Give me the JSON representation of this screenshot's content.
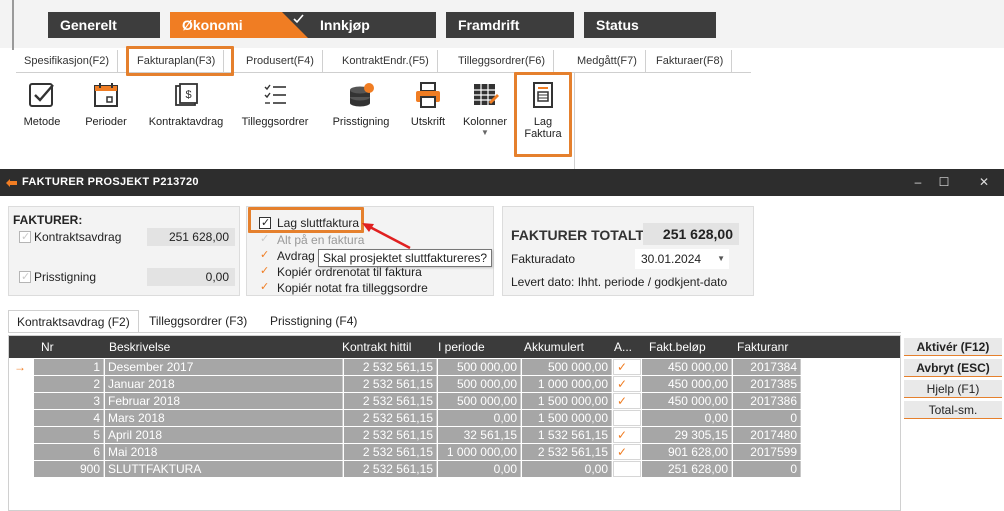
{
  "module_tabs": [
    {
      "label": "Generelt"
    },
    {
      "label": "Økonomi"
    },
    {
      "label": "Innkjøp"
    },
    {
      "label": "Framdrift"
    },
    {
      "label": "Status"
    }
  ],
  "ribbon_tabs": [
    {
      "label": "Spesifikasjon(F2)"
    },
    {
      "label": "Fakturaplan(F3)"
    },
    {
      "label": "Produsert(F4)"
    },
    {
      "label": "KontraktEndr.(F5)"
    },
    {
      "label": "Tilleggsordrer(F6)"
    },
    {
      "label": "Medgått(F7)"
    },
    {
      "label": "Fakturaer(F8)"
    }
  ],
  "tools": [
    {
      "label": "Metode",
      "icon": "checkbox-icon"
    },
    {
      "label": "Perioder",
      "icon": "calendar-icon"
    },
    {
      "label": "Kontraktavdrag",
      "icon": "money-icon"
    },
    {
      "label": "Tilleggsordrer",
      "icon": "list-icon"
    },
    {
      "label": "Prisstigning",
      "icon": "coins-icon"
    },
    {
      "label": "Utskrift",
      "icon": "printer-icon"
    },
    {
      "label": "Kolonner",
      "icon": "columns-icon"
    },
    {
      "label": "Lag",
      "label2": "Faktura",
      "icon": "invoice-icon"
    }
  ],
  "window": {
    "title": "FAKTURER PROSJEKT P213720",
    "min": "–",
    "max": "☐",
    "close": "✕"
  },
  "fakturer": {
    "header": "FAKTURER:",
    "kontraktsavdrag_label": "Kontraktsavdrag",
    "kontraktsavdrag_value": "251 628,00",
    "prisstigning_label": "Prisstigning",
    "prisstigning_value": "0,00"
  },
  "options": {
    "lag_sluttfaktura": "Lag sluttfaktura",
    "alt_pa_en": "Alt på en faktura",
    "avdrag_og": "Avdrag og",
    "kopier_ordrenotat": "Kopiér ordrenotat til faktura",
    "kopier_notat": "Kopiér notat fra tilleggsordre",
    "tooltip": "Skal prosjektet sluttfaktureres?"
  },
  "totals": {
    "label": "FAKTURER TOTALT:",
    "value": "251 628,00",
    "fakturadato_label": "Fakturadato",
    "fakturadato_value": "30.01.2024",
    "levert": "Levert dato: Ihht. periode / godkjent-dato"
  },
  "grid_tabs": [
    {
      "label": "Kontraktsavdrag (F2)"
    },
    {
      "label": "Tilleggsordrer (F3)"
    },
    {
      "label": "Prisstigning (F4)"
    }
  ],
  "grid": {
    "columns": [
      "Nr",
      "Beskrivelse",
      "Kontrakt hittil",
      "I periode",
      "Akkumulert",
      "A...",
      "Fakt.beløp",
      "Fakturanr"
    ],
    "rows": [
      {
        "nr": "1",
        "desc": "Desember 2017",
        "kontrakt": "2 532 561,15",
        "periode": "500 000,00",
        "akk": "500 000,00",
        "a": true,
        "belop": "450 000,00",
        "fnr": "2017384"
      },
      {
        "nr": "2",
        "desc": "Januar 2018",
        "kontrakt": "2 532 561,15",
        "periode": "500 000,00",
        "akk": "1 000 000,00",
        "a": true,
        "belop": "450 000,00",
        "fnr": "2017385"
      },
      {
        "nr": "3",
        "desc": "Februar 2018",
        "kontrakt": "2 532 561,15",
        "periode": "500 000,00",
        "akk": "1 500 000,00",
        "a": true,
        "belop": "450 000,00",
        "fnr": "2017386"
      },
      {
        "nr": "4",
        "desc": "Mars 2018",
        "kontrakt": "2 532 561,15",
        "periode": "0,00",
        "akk": "1 500 000,00",
        "a": false,
        "belop": "0,00",
        "fnr": "0"
      },
      {
        "nr": "5",
        "desc": "April 2018",
        "kontrakt": "2 532 561,15",
        "periode": "32 561,15",
        "akk": "1 532 561,15",
        "a": true,
        "belop": "29 305,15",
        "fnr": "2017480"
      },
      {
        "nr": "6",
        "desc": "Mai 2018",
        "kontrakt": "2 532 561,15",
        "periode": "1 000 000,00",
        "akk": "2 532 561,15",
        "a": true,
        "belop": "901 628,00",
        "fnr": "2017599"
      },
      {
        "nr": "900",
        "desc": "SLUTTFAKTURA",
        "kontrakt": "2 532 561,15",
        "periode": "0,00",
        "akk": "0,00",
        "a": false,
        "belop": "251 628,00",
        "fnr": "0"
      }
    ]
  },
  "side_buttons": [
    {
      "label": "Aktivér (F12)"
    },
    {
      "label": "Avbryt (ESC)"
    },
    {
      "label": "Hjelp (F1)"
    },
    {
      "label": "Total-sm."
    }
  ],
  "colors": {
    "accent": "#f07d23",
    "dark": "#3d3d3d",
    "row": "#a6a6a6"
  }
}
